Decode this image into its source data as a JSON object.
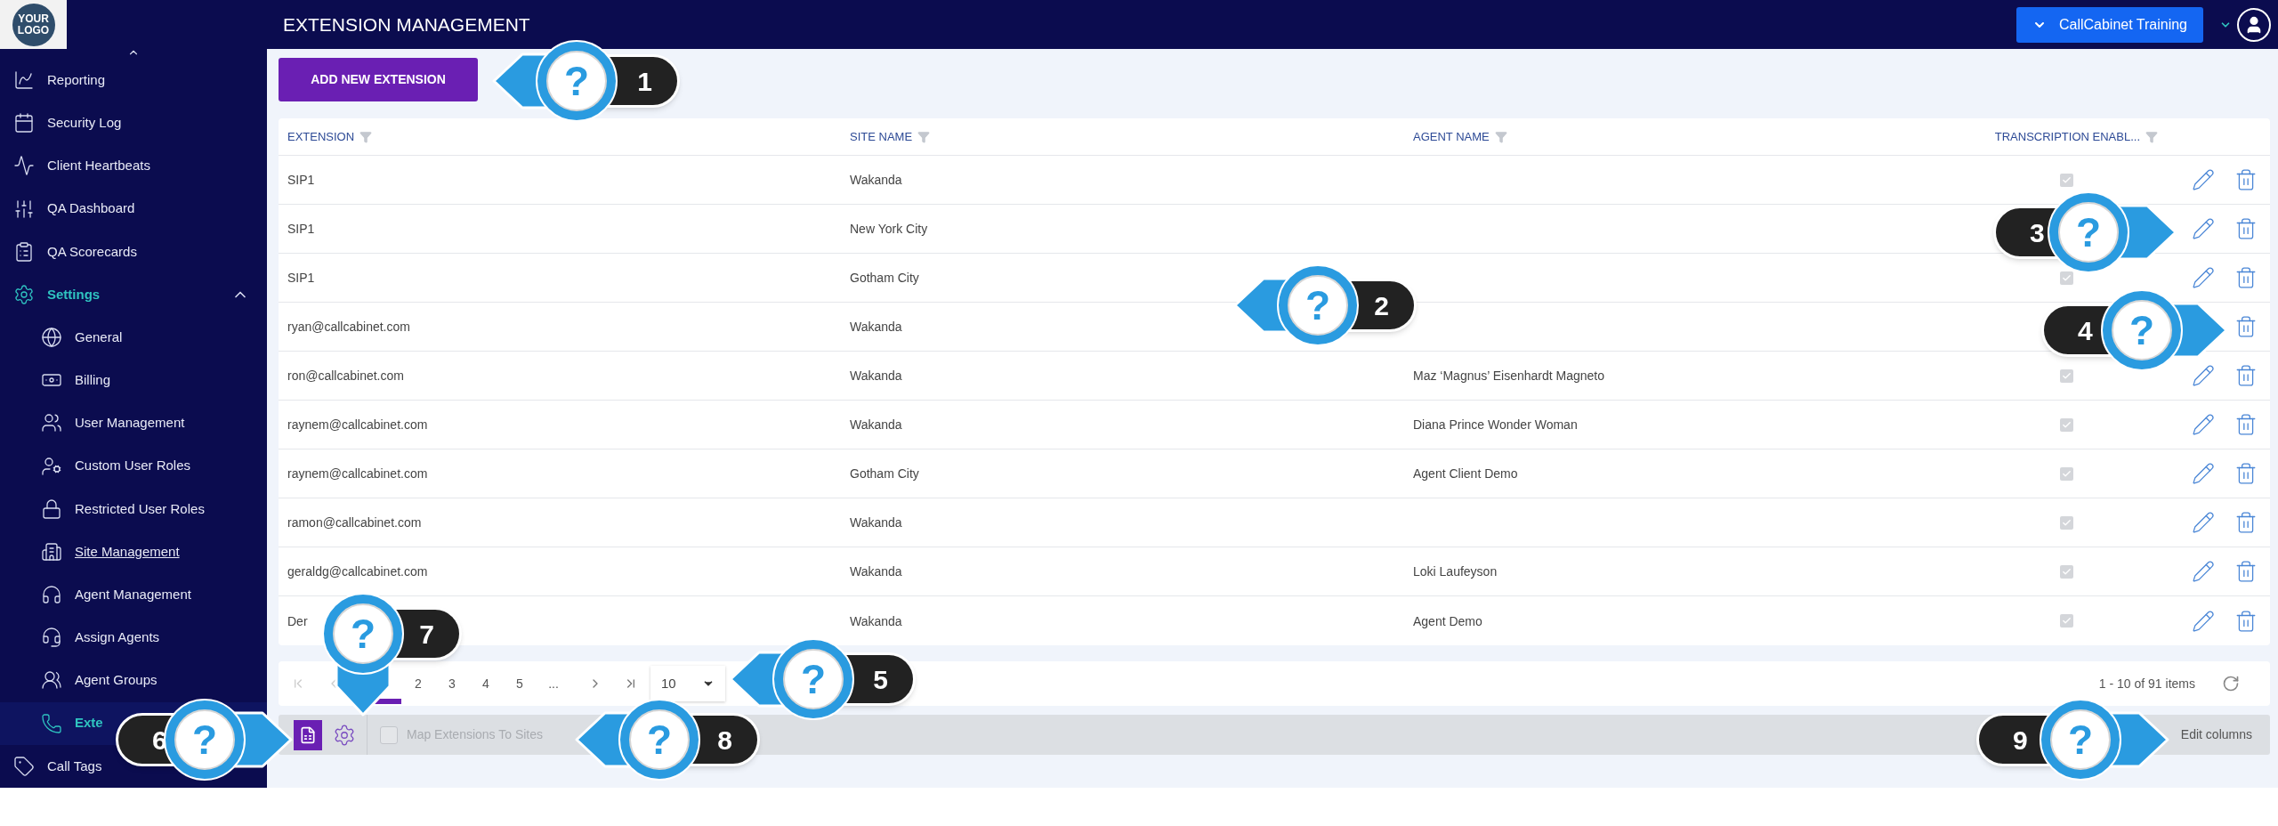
{
  "header": {
    "logo": "YOUR LOGO",
    "title": "EXTENSION MANAGEMENT",
    "account_button": "CallCabinet Training"
  },
  "sidebar": {
    "items": [
      {
        "label": "Reporting",
        "selected": false,
        "hovered": false
      },
      {
        "label": "Security Log",
        "selected": false,
        "hovered": false
      },
      {
        "label": "Client Heartbeats",
        "selected": false,
        "hovered": false
      },
      {
        "label": "QA Dashboard",
        "selected": false,
        "hovered": false
      },
      {
        "label": "QA Scorecards",
        "selected": false,
        "hovered": false
      },
      {
        "label": "Settings",
        "selected": false,
        "hovered": false,
        "expanded": true,
        "children": [
          {
            "label": "General",
            "selected": false,
            "hovered": false
          },
          {
            "label": "Billing",
            "selected": false,
            "hovered": false
          },
          {
            "label": "User Management",
            "selected": false,
            "hovered": false
          },
          {
            "label": "Custom User Roles",
            "selected": false,
            "hovered": false
          },
          {
            "label": "Restricted User Roles",
            "selected": false,
            "hovered": false
          },
          {
            "label": "Site Management",
            "selected": false,
            "hovered": true
          },
          {
            "label": "Agent Management",
            "selected": false,
            "hovered": false
          },
          {
            "label": "Assign Agents",
            "selected": false,
            "hovered": false
          },
          {
            "label": "Agent Groups",
            "selected": false,
            "hovered": false
          },
          {
            "label": "Exte",
            "selected": true,
            "hovered": false
          }
        ]
      },
      {
        "label": "Call Tags",
        "selected": false,
        "hovered": false
      }
    ]
  },
  "add_button": "ADD NEW EXTENSION",
  "table": {
    "columns": [
      {
        "label": "EXTENSION"
      },
      {
        "label": "SITE NAME"
      },
      {
        "label": "AGENT NAME"
      },
      {
        "label": "TRANSCRIPTION ENABL..."
      }
    ],
    "rows": [
      {
        "extension": "SIP1",
        "site_name": "Wakanda",
        "transcription_enabled": true,
        "actions": [
          {
            "kind": "edit"
          },
          {
            "kind": "delete"
          }
        ]
      },
      {
        "extension": "SIP1",
        "site_name": "New York City",
        "actions": [
          {
            "kind": "edit"
          },
          {
            "kind": "delete"
          }
        ]
      },
      {
        "extension": "SIP1",
        "site_name": "Gotham City",
        "transcription_enabled": true,
        "actions": [
          {
            "kind": "edit"
          },
          {
            "kind": "delete"
          }
        ]
      },
      {
        "extension": "ryan@callcabinet.com",
        "site_name": "Wakanda",
        "actions": [
          {
            "kind": "delete"
          }
        ]
      },
      {
        "extension": "ron@callcabinet.com",
        "site_name": "Wakanda",
        "agent_name": "Maz ‘Magnus’ Eisenhardt Magneto",
        "transcription_enabled": true,
        "actions": [
          {
            "kind": "edit"
          },
          {
            "kind": "delete"
          }
        ]
      },
      {
        "extension": "raynem@callcabinet.com",
        "site_name": "Wakanda",
        "agent_name": "Diana Prince Wonder Woman",
        "transcription_enabled": true,
        "actions": [
          {
            "kind": "edit"
          },
          {
            "kind": "delete"
          }
        ]
      },
      {
        "extension": "raynem@callcabinet.com",
        "site_name": "Gotham City",
        "agent_name": "Agent Client Demo",
        "transcription_enabled": true,
        "actions": [
          {
            "kind": "edit"
          },
          {
            "kind": "delete"
          }
        ]
      },
      {
        "extension": "ramon@callcabinet.com",
        "site_name": "Wakanda",
        "transcription_enabled": true,
        "actions": [
          {
            "kind": "edit"
          },
          {
            "kind": "delete"
          }
        ]
      },
      {
        "extension": "geraldg@callcabinet.com",
        "site_name": "Wakanda",
        "agent_name": "Loki Laufeyson",
        "transcription_enabled": true,
        "actions": [
          {
            "kind": "edit"
          },
          {
            "kind": "delete"
          }
        ]
      },
      {
        "extension": "Der",
        "site_name": "Wakanda",
        "agent_name": "Agent Demo",
        "transcription_enabled": true,
        "actions": [
          {
            "kind": "edit"
          },
          {
            "kind": "delete"
          }
        ]
      }
    ]
  },
  "pagination": {
    "pages": [
      {
        "selected": true
      },
      {
        "label": "2",
        "selected": false
      },
      {
        "label": "3",
        "selected": false
      },
      {
        "label": "4",
        "selected": false
      },
      {
        "label": "5",
        "selected": false
      },
      {
        "label": "...",
        "selected": false
      }
    ],
    "page_size": "10",
    "summary": "1 - 10 of 91 items"
  },
  "toolbar": {
    "map_extensions": {
      "label": "Map Extensions To Sites",
      "checked": false
    },
    "edit_columns": "Edit columns"
  },
  "callouts": [
    {
      "number": "1",
      "symbol": "?"
    },
    {
      "number": "2",
      "symbol": "?"
    },
    {
      "number": "3",
      "symbol": "?"
    },
    {
      "number": "4",
      "symbol": "?"
    },
    {
      "number": "5",
      "symbol": "?"
    },
    {
      "number": "6",
      "symbol": "?"
    },
    {
      "number": "7",
      "symbol": "?"
    },
    {
      "number": "8",
      "symbol": "?"
    },
    {
      "number": "9",
      "symbol": "?"
    }
  ]
}
